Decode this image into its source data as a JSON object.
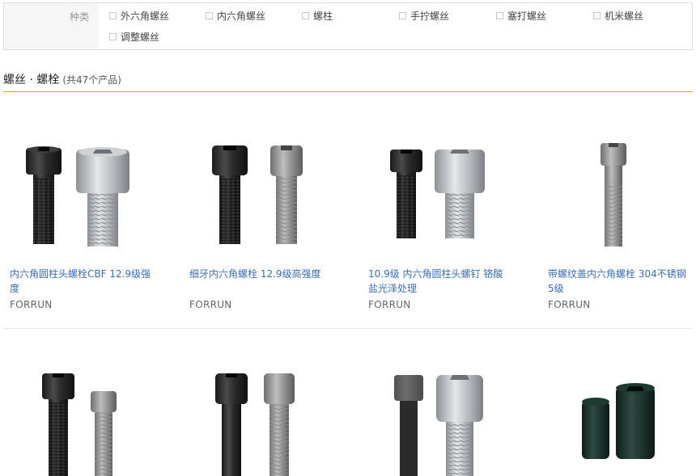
{
  "filter": {
    "label": "种类",
    "options": [
      "外六角螺丝",
      "内六角螺丝",
      "螺柱",
      "手拧螺丝",
      "塞打螺丝",
      "机米螺丝",
      "调整螺丝"
    ]
  },
  "section": {
    "title": "螺丝 · 螺栓",
    "count": "(共47个产品)"
  },
  "products": [
    {
      "title": "内六角圆柱头螺栓CBF 12.9级强度",
      "brand": "FORRUN"
    },
    {
      "title": "细牙内六角螺栓 12.9级高强度",
      "brand": "FORRUN"
    },
    {
      "title": "10.9级 内六角圆柱头螺钉 铬酸盐光泽处理",
      "brand": "FORRUN"
    },
    {
      "title": "带螺纹盖内六角螺栓 304不锈钢 5级",
      "brand": "FORRUN"
    }
  ],
  "colors": {
    "accent_line": "#e6a11a",
    "link": "#3a6dba"
  }
}
